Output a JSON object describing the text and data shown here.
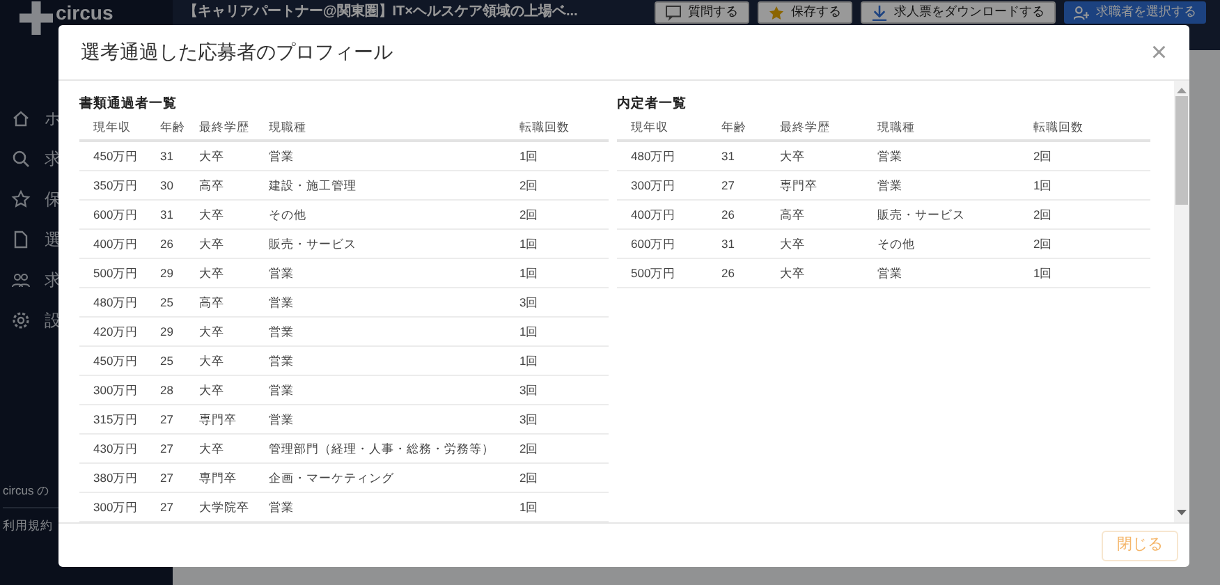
{
  "background": {
    "logo": "circus",
    "job_title": "【キャリアパートナー@関東圏】IT×ヘルスケア領域の上場ベ...",
    "header_buttons": [
      {
        "label": "質問する",
        "kind": "plain"
      },
      {
        "label": "保存する",
        "kind": "star"
      },
      {
        "label": "求人票をダウンロードする",
        "kind": "download"
      },
      {
        "label": "求職者を選択する",
        "kind": "primary"
      }
    ],
    "sidebar_items": [
      {
        "label": "ホ"
      },
      {
        "label": "求"
      },
      {
        "label": "保"
      },
      {
        "label": "選"
      },
      {
        "label": "求"
      },
      {
        "label": "設"
      }
    ],
    "footer_links": [
      "circus の",
      "利用規約"
    ]
  },
  "modal": {
    "title": "選考通過した応募者のプロフィール",
    "close": "×",
    "tables": [
      {
        "title": "書類通過者一覧",
        "columns": [
          "現年収",
          "年齢",
          "最終学歴",
          "現職種",
          "転職回数"
        ],
        "rows": [
          [
            "450万円",
            "31",
            "大卒",
            "営業",
            "1回"
          ],
          [
            "350万円",
            "30",
            "高卒",
            "建設・施工管理",
            "2回"
          ],
          [
            "600万円",
            "31",
            "大卒",
            "その他",
            "2回"
          ],
          [
            "400万円",
            "26",
            "大卒",
            "販売・サービス",
            "1回"
          ],
          [
            "500万円",
            "29",
            "大卒",
            "営業",
            "1回"
          ],
          [
            "480万円",
            "25",
            "高卒",
            "営業",
            "3回"
          ],
          [
            "420万円",
            "29",
            "大卒",
            "営業",
            "1回"
          ],
          [
            "450万円",
            "25",
            "大卒",
            "営業",
            "1回"
          ],
          [
            "300万円",
            "28",
            "大卒",
            "営業",
            "3回"
          ],
          [
            "315万円",
            "27",
            "専門卒",
            "営業",
            "3回"
          ],
          [
            "430万円",
            "27",
            "大卒",
            "管理部門（経理・人事・総務・労務等）",
            "2回"
          ],
          [
            "380万円",
            "27",
            "専門卒",
            "企画・マーケティング",
            "2回"
          ],
          [
            "300万円",
            "27",
            "大学院卒",
            "営業",
            "1回"
          ]
        ]
      },
      {
        "title": "内定者一覧",
        "columns": [
          "現年収",
          "年齢",
          "最終学歴",
          "現職種",
          "転職回数"
        ],
        "rows": [
          [
            "480万円",
            "31",
            "大卒",
            "営業",
            "2回"
          ],
          [
            "300万円",
            "27",
            "専門卒",
            "営業",
            "1回"
          ],
          [
            "400万円",
            "26",
            "高卒",
            "販売・サービス",
            "2回"
          ],
          [
            "600万円",
            "31",
            "大卒",
            "その他",
            "2回"
          ],
          [
            "500万円",
            "26",
            "大卒",
            "営業",
            "1回"
          ]
        ]
      }
    ],
    "footer_button": "閉じる"
  }
}
